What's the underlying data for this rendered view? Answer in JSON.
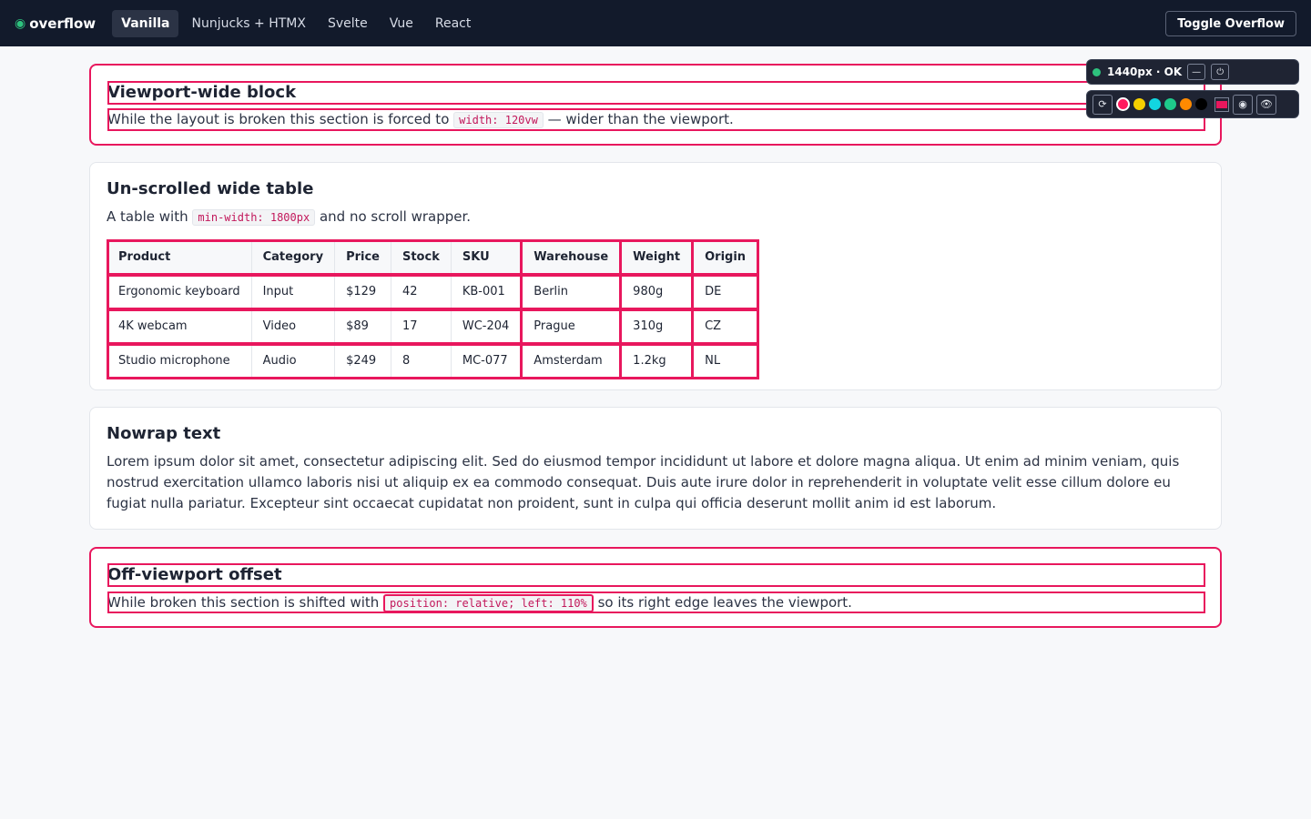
{
  "header": {
    "brand": "overflow",
    "tabs": [
      {
        "label": "Vanilla",
        "active": true
      },
      {
        "label": "Nunjucks + HTMX"
      },
      {
        "label": "Svelte"
      },
      {
        "label": "Vue"
      },
      {
        "label": "React"
      }
    ],
    "toggle_label": "Toggle Overflow"
  },
  "widget": {
    "status": "1440px · OK",
    "minimize_glyph": "—",
    "power_glyph": "⏻",
    "reset_glyph": "⟳",
    "swatches": [
      "#ff1a5e",
      "#f5d000",
      "#12d6e0",
      "#1ec98b",
      "#ff8a00",
      "#000000"
    ],
    "selected_swatch": "#ff1a5e",
    "fill_color": "#e8175d",
    "target_glyph": "◉",
    "eye_glyph": "👁"
  },
  "sections": {
    "viewport": {
      "title": "Viewport-wide block",
      "text_before": "While the layout is broken this section is forced to ",
      "code": "width: 120vw",
      "text_after": " — wider than the viewport."
    },
    "table": {
      "title": "Un-scrolled wide table",
      "text_before": "A table with ",
      "code": "min-width: 1800px",
      "text_after": " and no scroll wrapper.",
      "columns": [
        "Product",
        "Category",
        "Price",
        "Stock",
        "SKU",
        "Warehouse",
        "Weight",
        "Origin"
      ],
      "rows": [
        [
          "Ergonomic keyboard",
          "Input",
          "$129",
          "42",
          "KB-001",
          "Berlin",
          "980g",
          "DE"
        ],
        [
          "4K webcam",
          "Video",
          "$89",
          "17",
          "WC-204",
          "Prague",
          "310g",
          "CZ"
        ],
        [
          "Studio microphone",
          "Audio",
          "$249",
          "8",
          "MC-077",
          "Amsterdam",
          "1.2kg",
          "NL"
        ]
      ]
    },
    "nowrap": {
      "title": "Nowrap text",
      "text": "Lorem ipsum dolor sit amet, consectetur adipiscing elit. Sed do eiusmod tempor incididunt ut labore et dolore magna aliqua. Ut enim ad minim veniam, quis nostrud exercitation ullamco laboris nisi ut aliquip ex ea commodo consequat. Duis aute irure dolor in reprehenderit in voluptate velit esse cillum dolore eu fugiat nulla pariatur. Excepteur sint occaecat cupidatat non proident, sunt in culpa qui officia deserunt mollit anim id est laborum."
    },
    "offset": {
      "title": "Off-viewport offset",
      "text_before": "While broken this section is shifted with ",
      "code": "position: relative; left: 110%",
      "text_after": " so its right edge leaves the viewport."
    }
  }
}
